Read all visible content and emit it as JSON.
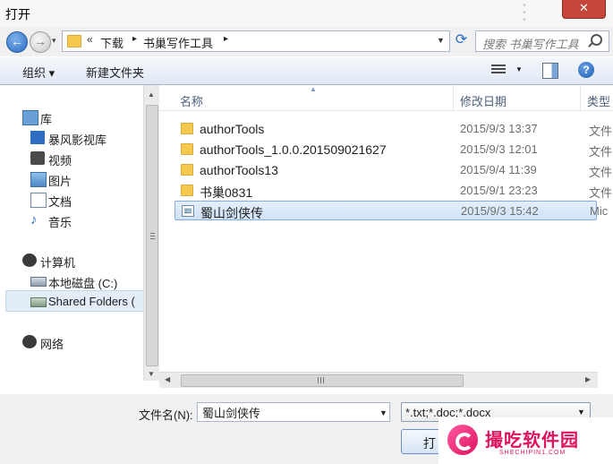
{
  "window": {
    "title": "打开",
    "close_glyph": "✕"
  },
  "address": {
    "chevron": "«",
    "breadcrumbs": [
      "下载",
      "书巢写作工具"
    ],
    "separator": "▸"
  },
  "search": {
    "placeholder": "搜索 书巢写作工具"
  },
  "toolbar": {
    "organize": "组织 ▾",
    "new_folder": "新建文件夹",
    "help": "?"
  },
  "nav": {
    "items": [
      {
        "label": "库",
        "icon": "library-icon"
      },
      {
        "label": "暴风影视库",
        "icon": "video-library-icon"
      },
      {
        "label": "视频",
        "icon": "video-icon"
      },
      {
        "label": "图片",
        "icon": "pictures-icon"
      },
      {
        "label": "文档",
        "icon": "documents-icon"
      },
      {
        "label": "音乐",
        "icon": "music-icon"
      },
      {
        "label": "计算机",
        "icon": "computer-icon"
      },
      {
        "label": "本地磁盘 (C:)",
        "icon": "drive-icon"
      },
      {
        "label": "Shared Folders (",
        "icon": "network-drive-icon"
      },
      {
        "label": "网络",
        "icon": "network-icon"
      }
    ],
    "selected": "Shared Folders ("
  },
  "columns": {
    "name": "名称",
    "modified": "修改日期",
    "type": "类型"
  },
  "files": [
    {
      "name": "authorTools",
      "date": "2015/9/3 13:37",
      "type": "文件",
      "kind": "folder"
    },
    {
      "name": "authorTools_1.0.0.201509021627",
      "date": "2015/9/3 12:01",
      "type": "文件",
      "kind": "folder"
    },
    {
      "name": "authorTools13",
      "date": "2015/9/4 11:39",
      "type": "文件",
      "kind": "folder"
    },
    {
      "name": "书巢0831",
      "date": "2015/9/1 23:23",
      "type": "文件",
      "kind": "folder"
    },
    {
      "name": "蜀山剑侠传",
      "date": "2015/9/3 15:42",
      "type": "Mic",
      "kind": "document",
      "selected": true
    }
  ],
  "bottom": {
    "filename_label": "文件名(N):",
    "filename_value": "蜀山剑侠传",
    "filter_value": "*.txt;*.doc;*.docx",
    "open_label": "打"
  },
  "watermark": {
    "text": "撮吃软件园",
    "sub": "SHECHIPIN1.COM"
  }
}
